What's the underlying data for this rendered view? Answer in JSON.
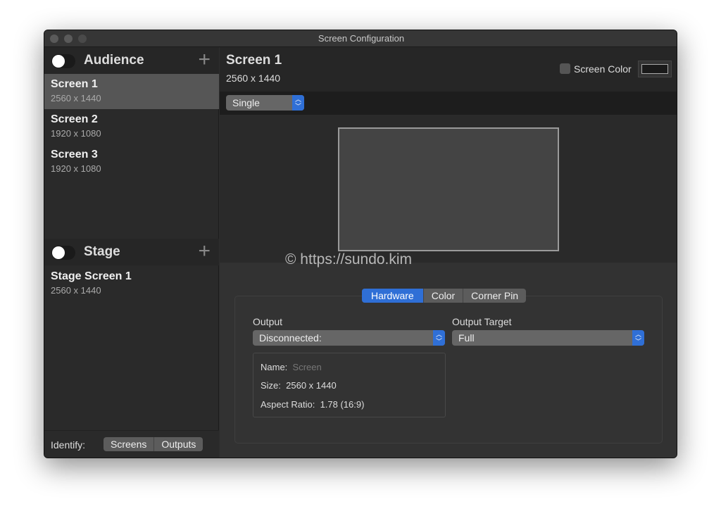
{
  "window": {
    "title": "Screen Configuration"
  },
  "audience": {
    "title": "Audience",
    "items": [
      {
        "name": "Screen 1",
        "size": "2560 x 1440",
        "selected": true
      },
      {
        "name": "Screen 2",
        "size": "1920 x 1080"
      },
      {
        "name": "Screen 3",
        "size": "1920 x 1080"
      }
    ]
  },
  "stage": {
    "title": "Stage",
    "items": [
      {
        "name": "Stage Screen 1",
        "size": "2560 x 1440"
      }
    ]
  },
  "identify": {
    "label": "Identify:",
    "screens": "Screens",
    "outputs": "Outputs"
  },
  "detail": {
    "title": "Screen 1",
    "size": "2560 x 1440",
    "screen_color_label": "Screen Color",
    "screen_color": "#1a1a1a",
    "mode": "Single"
  },
  "tabs": [
    {
      "label": "Hardware",
      "active": true
    },
    {
      "label": "Color"
    },
    {
      "label": "Corner Pin"
    }
  ],
  "output": {
    "label": "Output",
    "value": "Disconnected:"
  },
  "output_target": {
    "label": "Output Target",
    "value": "Full"
  },
  "info": {
    "name_label": "Name:",
    "name_placeholder": "Screen",
    "size_label": "Size:",
    "size": "2560 x 1440",
    "aspect_label": "Aspect Ratio:",
    "aspect": "1.78 (16:9)"
  },
  "watermark": "© https://sundo.kim",
  "colors": {
    "accent": "#2f6fd6"
  }
}
